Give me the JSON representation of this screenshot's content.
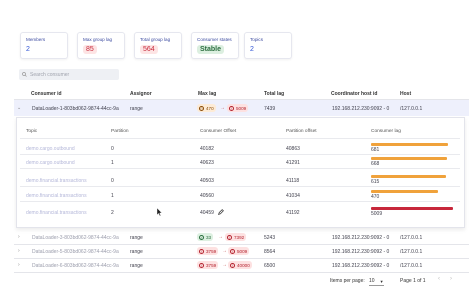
{
  "stats": [
    {
      "label": "Members",
      "value": "2"
    },
    {
      "label": "Max group lag",
      "value": "85"
    },
    {
      "label": "Total group lag",
      "value": "564"
    },
    {
      "label": "Consumer states",
      "value": "Stable"
    },
    {
      "label": "Topics",
      "value": "2"
    }
  ],
  "search": {
    "placeholder": "Search consumer"
  },
  "columns": [
    "Consumer id",
    "Assignor",
    "Max lag",
    "Total lag",
    "Coordinator host id",
    "Host"
  ],
  "expanded_row": {
    "consumer_id": "DataLoader-1-803bd062-9874-44cc-9a",
    "assignor": "range",
    "max_lag_from": "470",
    "max_lag_to": "5009",
    "total_lag": "7439",
    "coordinator": "192.168.212.230:9092 - 0",
    "host": "/127.0.0.1"
  },
  "detail": {
    "columns": [
      "Topic",
      "Partition",
      "Consumer Offset",
      "Partition offset",
      "Consumer lag"
    ],
    "rows": [
      {
        "topic": "demo.cargo.outbound",
        "partition": "0",
        "consumer_offset": "40182",
        "partition_offset": "40863",
        "lag": "681",
        "lag_frac": 0.136,
        "color": "orange"
      },
      {
        "topic": "demo.cargo.outbound",
        "partition": "1",
        "consumer_offset": "40623",
        "partition_offset": "41291",
        "lag": "668",
        "lag_frac": 0.133,
        "color": "orange"
      },
      {
        "topic": "demo.financial.transactions",
        "partition": "0",
        "consumer_offset": "40503",
        "partition_offset": "41118",
        "lag": "615",
        "lag_frac": 0.123,
        "color": "orange"
      },
      {
        "topic": "demo.financial.transactions",
        "partition": "1",
        "consumer_offset": "40560",
        "partition_offset": "41034",
        "lag": "470",
        "lag_frac": 0.094,
        "color": "orange"
      },
      {
        "topic": "demo.financial.transactions",
        "partition": "2",
        "consumer_offset": "40459",
        "partition_offset": "41192",
        "lag": "5009",
        "lag_frac": 1.0,
        "color": "red"
      }
    ]
  },
  "rows": [
    {
      "consumer_id": "DataLoader-3-803bd062-9874-44cc-9a",
      "assignor": "range",
      "lag_from": "33",
      "lag_to": "7392",
      "lag_from_kind": "green",
      "total_lag": "5243",
      "coordinator": "192.168.212.230:9092 - 0",
      "host": "/127.0.0.1"
    },
    {
      "consumer_id": "DataLoader-5-803bd062-9874-44cc-9a",
      "assignor": "range",
      "lag_from": "3759",
      "lag_to": "5009",
      "lag_from_kind": "red",
      "total_lag": "8564",
      "coordinator": "192.168.212.230:9092 - 0",
      "host": "/127.0.0.1"
    },
    {
      "consumer_id": "DataLoader-6-803bd062-9874-44cc-9a",
      "assignor": "range",
      "lag_from": "3759",
      "lag_to": "40000",
      "lag_from_kind": "red",
      "total_lag": "6500",
      "coordinator": "192.168.212.230:9092 - 0",
      "host": "/127.0.0.1"
    }
  ],
  "footer": {
    "items_per_page_label": "Items per page:",
    "items_per_page_value": "10",
    "page_label": "Page 1 of 1"
  }
}
